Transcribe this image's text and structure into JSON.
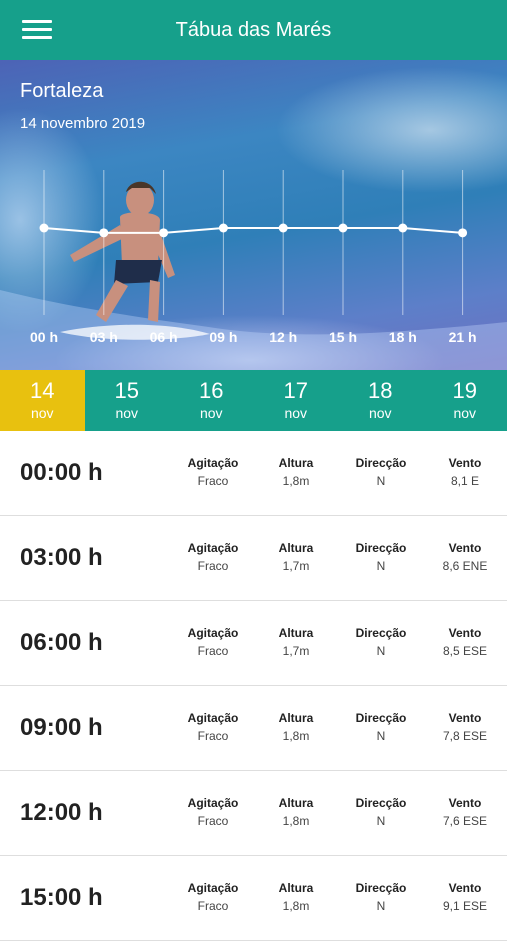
{
  "header": {
    "title": "Tábua das Marés",
    "menu_icon": "hamburger-menu-icon"
  },
  "location": {
    "city": "Fortaleza",
    "date": "14 novembro 2019"
  },
  "chart_data": {
    "type": "line",
    "x": [
      "00 h",
      "03 h",
      "06 h",
      "09 h",
      "12 h",
      "15 h",
      "18 h",
      "21 h"
    ],
    "values": [
      1.8,
      1.7,
      1.7,
      1.8,
      1.8,
      1.8,
      1.8,
      1.7
    ],
    "ylim": [
      0,
      3.0
    ],
    "grid": true
  },
  "days": [
    {
      "num": "14",
      "month": "nov",
      "active": true
    },
    {
      "num": "15",
      "month": "nov"
    },
    {
      "num": "16",
      "month": "nov"
    },
    {
      "num": "17",
      "month": "nov"
    },
    {
      "num": "18",
      "month": "nov"
    },
    {
      "num": "19",
      "month": "nov"
    }
  ],
  "labels": {
    "agitacao": "Agitação",
    "altura": "Altura",
    "direccao": "Direcção",
    "vento": "Vento"
  },
  "rows": [
    {
      "time": "00:00 h",
      "agitacao": "Fraco",
      "altura": "1,8m",
      "direccao": "N",
      "vento": "8,1 E"
    },
    {
      "time": "03:00 h",
      "agitacao": "Fraco",
      "altura": "1,7m",
      "direccao": "N",
      "vento": "8,6 ENE"
    },
    {
      "time": "06:00 h",
      "agitacao": "Fraco",
      "altura": "1,7m",
      "direccao": "N",
      "vento": "8,5 ESE"
    },
    {
      "time": "09:00 h",
      "agitacao": "Fraco",
      "altura": "1,8m",
      "direccao": "N",
      "vento": "7,8 ESE"
    },
    {
      "time": "12:00 h",
      "agitacao": "Fraco",
      "altura": "1,8m",
      "direccao": "N",
      "vento": "7,6 ESE"
    },
    {
      "time": "15:00 h",
      "agitacao": "Fraco",
      "altura": "1,8m",
      "direccao": "N",
      "vento": "9,1 ESE"
    }
  ],
  "colors": {
    "primary": "#16a08b",
    "active_day": "#e8c10f"
  }
}
